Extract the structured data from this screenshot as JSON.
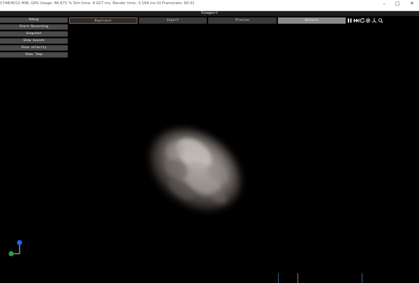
{
  "window": {
    "title": "1748/4011 MiB, GPU Usage: 66.671 %   Sim time: 4.027 ms, Render time: 3.169 ms   UI Framerate: 60.01",
    "min_glyph": "–",
    "max_glyph": "□",
    "close_glyph": "✕"
  },
  "viewport": {
    "title": "Viewport"
  },
  "debug_panel": {
    "items": [
      "Debug",
      "Start Recording",
      "Snapshot",
      "Show bounds",
      "Show velocity",
      "Show Temp"
    ]
  },
  "tabs": [
    {
      "label": "Raytracer",
      "active": true
    },
    {
      "label": "Export"
    },
    {
      "label": "Preview"
    },
    {
      "label": "Default"
    }
  ],
  "toolbar_icons": [
    "pause-icon",
    "fast-forward-icon",
    "refresh-icon",
    "gear-icon",
    "axes-icon",
    "search-icon"
  ],
  "colors": {
    "active_tab_border": "#b05a28",
    "axis_x": "#2ea043",
    "axis_y": "#2563eb",
    "status_line": "#2b6e8a"
  }
}
